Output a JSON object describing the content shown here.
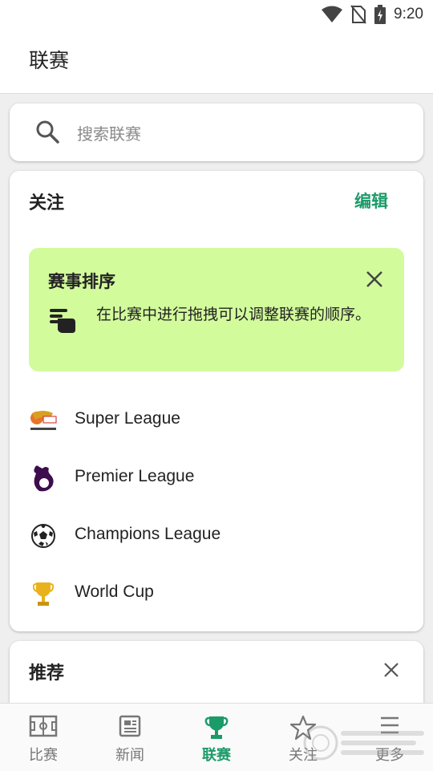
{
  "status_bar": {
    "time": "9:20"
  },
  "app_bar": {
    "title": "联赛"
  },
  "search": {
    "placeholder": "搜索联赛"
  },
  "follow": {
    "title": "关注",
    "edit_label": "编辑",
    "tip": {
      "title": "赛事排序",
      "text": "在比赛中进行拖拽可以调整联赛的顺序。"
    },
    "leagues": [
      {
        "name": "Super League",
        "icon": "super-league-logo"
      },
      {
        "name": "Premier League",
        "icon": "premier-league-logo"
      },
      {
        "name": "Champions League",
        "icon": "soccer-ball-icon"
      },
      {
        "name": "World Cup",
        "icon": "trophy-icon"
      }
    ]
  },
  "recommend": {
    "title": "推荐"
  },
  "bottom_nav": {
    "items": [
      {
        "label": "比赛",
        "icon": "pitch-icon"
      },
      {
        "label": "新闻",
        "icon": "news-icon"
      },
      {
        "label": "联赛",
        "icon": "trophy-icon",
        "active": true
      },
      {
        "label": "关注",
        "icon": "star-icon"
      },
      {
        "label": "更多",
        "icon": "menu-icon"
      }
    ]
  },
  "colors": {
    "accent": "#1c9b6a",
    "tip_background": "#d2fb9c"
  }
}
